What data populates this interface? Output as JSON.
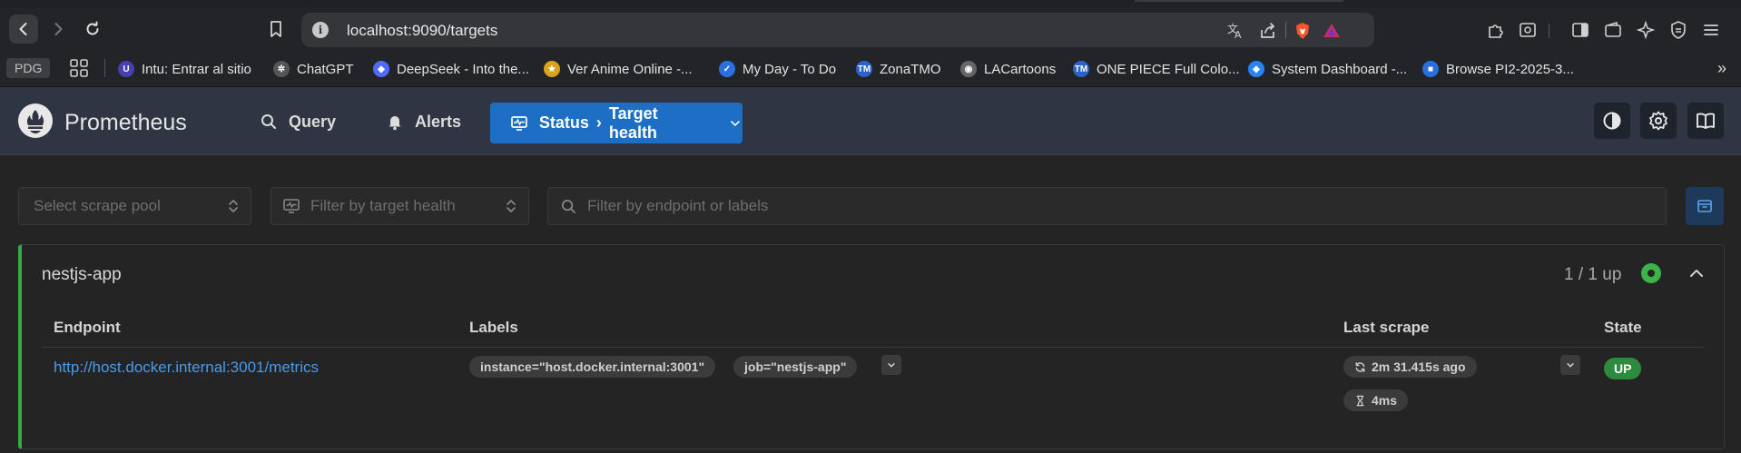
{
  "browser": {
    "url": "localhost:9090/targets",
    "bookmarks_chip": "PDG",
    "bookmarks": [
      {
        "label": "Intu: Entrar al sitio",
        "icon": "intu-icon",
        "color": "#4a3fb0"
      },
      {
        "label": "ChatGPT",
        "icon": "chatgpt-icon",
        "color": "#555555"
      },
      {
        "label": "DeepSeek - Into the...",
        "icon": "deepseek-icon",
        "color": "#4d6bfe"
      },
      {
        "label": "Ver Anime Online -...",
        "icon": "anime-icon",
        "color": "#d9a21b"
      },
      {
        "label": "My Day - To Do",
        "icon": "todo-icon",
        "color": "#2b6fe0"
      },
      {
        "label": "ZonaTMO",
        "icon": "zonatmo-icon",
        "color": "#2a62c9"
      },
      {
        "label": "LACartoons",
        "icon": "lacartoons-icon",
        "color": "#666666"
      },
      {
        "label": "ONE PIECE Full Colo...",
        "icon": "onepiece-icon",
        "color": "#2a62c9"
      },
      {
        "label": "System Dashboard -...",
        "icon": "jira-icon",
        "color": "#2684ff"
      },
      {
        "label": "Browse PI2-2025-3...",
        "icon": "jira-board-icon",
        "color": "#2a6fdb"
      }
    ],
    "more_label": "»"
  },
  "app": {
    "brand": "Prometheus",
    "nav": {
      "query": "Query",
      "alerts": "Alerts",
      "status": "Status",
      "status_sep": "›",
      "status_page": "Target health"
    }
  },
  "filters": {
    "scrape_pool_placeholder": "Select scrape pool",
    "health_placeholder": "Filter by target health",
    "search_placeholder": "Filter by endpoint or labels"
  },
  "pool": {
    "name": "nestjs-app",
    "up_count": "1 / 1 up",
    "columns": {
      "endpoint": "Endpoint",
      "labels": "Labels",
      "last_scrape": "Last scrape",
      "state": "State"
    },
    "targets": [
      {
        "endpoint": "http://host.docker.internal:3001/metrics",
        "labels": [
          "instance=\"host.docker.internal:3001\"",
          "job=\"nestjs-app\""
        ],
        "last_scrape": "2m 31.415s ago",
        "scrape_duration": "4ms",
        "state": "UP"
      }
    ]
  },
  "colors": {
    "accent": "#1c6fc5",
    "healthy": "#38a84a",
    "link": "#4a9ae8"
  }
}
